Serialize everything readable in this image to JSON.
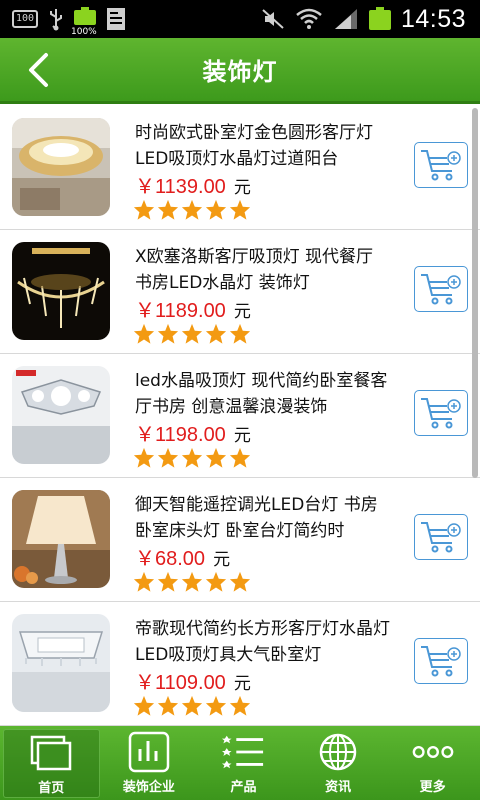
{
  "status_bar": {
    "battery_box_text": "100",
    "battery_percent": "100%",
    "time": "14:53"
  },
  "header": {
    "title": "装饰灯"
  },
  "products": [
    {
      "name": "时尚欧式卧室灯金色圆形客厅灯LED吸顶灯水晶灯过道阳台",
      "price": "￥1139.00",
      "unit": "元",
      "rating": 5
    },
    {
      "name": "X欧塞洛斯客厅吸顶灯 现代餐厅书房LED水晶灯 装饰灯",
      "price": "￥1189.00",
      "unit": "元",
      "rating": 5
    },
    {
      "name": "led水晶吸顶灯 现代简约卧室餐客厅书房 创意温馨浪漫装饰",
      "price": "￥1198.00",
      "unit": "元",
      "rating": 5
    },
    {
      "name": "御天智能遥控调光LED台灯 书房卧室床头灯 卧室台灯简约时",
      "price": "￥68.00",
      "unit": "元",
      "rating": 5
    },
    {
      "name": "帝歌现代简约长方形客厅灯水晶灯LED吸顶灯具大气卧室灯",
      "price": "￥1109.00",
      "unit": "元",
      "rating": 5
    }
  ],
  "bottom_nav": [
    {
      "label": "首页",
      "icon": "home-icon",
      "active": true
    },
    {
      "label": "装饰企业",
      "icon": "chart-icon",
      "active": false
    },
    {
      "label": "产品",
      "icon": "list-icon",
      "active": false
    },
    {
      "label": "资讯",
      "icon": "globe-icon",
      "active": false
    },
    {
      "label": "更多",
      "icon": "more-icon",
      "active": false
    }
  ],
  "colors": {
    "brand_green": "#4aa824",
    "price_red": "#e11d1d",
    "cart_blue": "#4a97d6",
    "star_orange": "#f39a12"
  }
}
